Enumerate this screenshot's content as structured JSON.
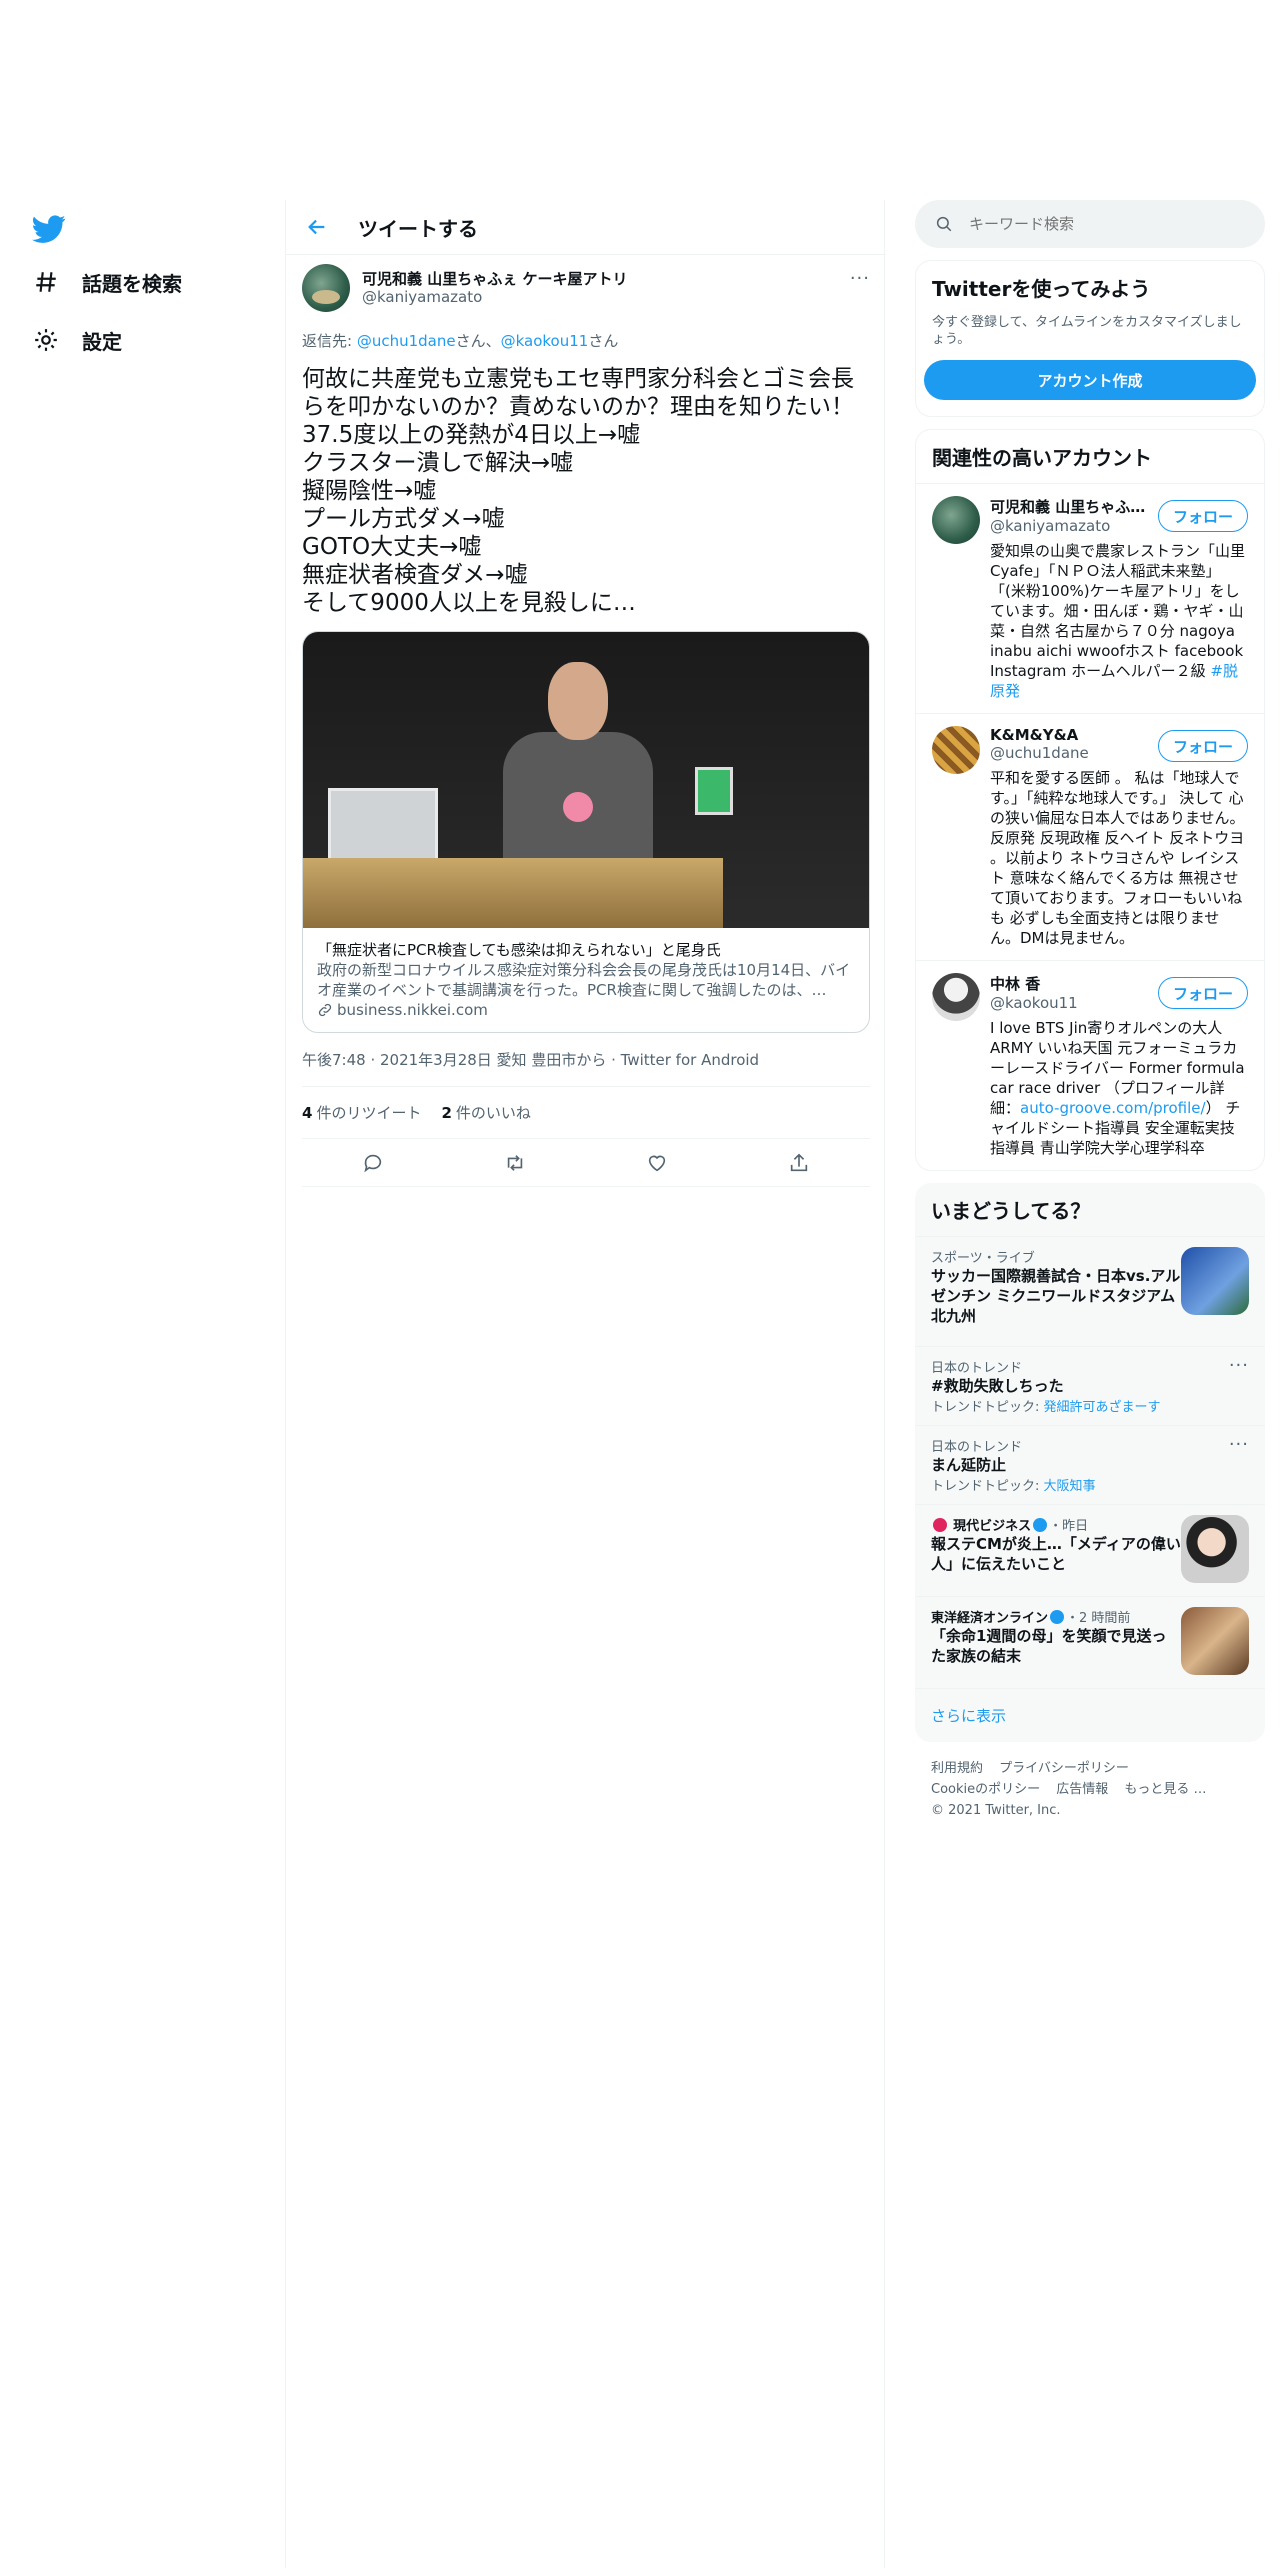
{
  "nav": {
    "explore_label": "話題を検索",
    "settings_label": "設定"
  },
  "header": {
    "title": "ツイートする"
  },
  "tweet": {
    "author_name": "可児和義 山里ちゃふぇ ケーキ屋アトリ",
    "author_handle": "@kaniyamazato",
    "more": "···",
    "reply_prefix": "返信先: ",
    "reply_user1": "@uchu1dane",
    "reply_san1": "さん、",
    "reply_user2": "@kaokou11",
    "reply_san2": "さん",
    "text": "何故に共産党も立憲党もエセ専門家分科会とゴミ会長らを叩かないのか？責めないのか？理由を知りたい！\n37.5度以上の発熱が4日以上→嘘\nクラスター潰しで解決→嘘\n擬陽陰性→嘘\nプール方式ダメ→嘘\nGOTO大丈夫→嘘\n無症状者検査ダメ→嘘\nそして9000人以上を見殺しに…",
    "card": {
      "title": "「無症状者にPCR検査しても感染は抑えられない」と尾身氏",
      "desc": "政府の新型コロナウイルス感染症対策分科会会長の尾身茂氏は10月14日、バイオ産業のイベントで基調講演を行った。PCR検査に関して強調したのは、…",
      "domain": "business.nikkei.com"
    },
    "meta": "午後7:48 · 2021年3月28日 愛知 豊田市から · Twitter for Android",
    "retweets_count": "4",
    "retweets_label": "件のリツイート",
    "likes_count": "2",
    "likes_label": "件のいいね"
  },
  "search": {
    "placeholder": "キーワード検索"
  },
  "signup": {
    "title": "Twitterを使ってみよう",
    "desc": "今すぐ登録して、タイムラインをカスタマイズしましょう。",
    "button": "アカウント作成"
  },
  "related": {
    "title": "関連性の高いアカウント",
    "follow_label": "フォロー",
    "accounts": [
      {
        "name": "可児和義 山里ちゃふぇ ケーキ屋アトリ",
        "handle": "@kaniyamazato",
        "bio": "愛知県の山奥で農家レストラン「山里Cyafe」「ＮＰＯ法人稲武未来塾」「(米粉100%)ケーキ屋アトリ」をしています。畑・田んぼ・鶏・ヤギ・山菜・自然 名古屋から７０分 nagoya inabu aichi wwoofホスト facebook Instagram ホームヘルパー２級 ",
        "bio_link": "#脱原発"
      },
      {
        "name": "K&M&Y&A",
        "handle": "@uchu1dane",
        "bio": "平和を愛する医師 。 私は「地球人です。」「純粋な地球人です。」 決して 心の狭い偏屈な日本人ではありません。反原発 反現政権 反ヘイト 反ネトウヨ 。以前より ネトウヨさんや レイシスト 意味なく絡んでくる方は 無視させて頂いております。フォローもいいねも 必ずしも全面支持とは限りません。DMは見ません。"
      },
      {
        "name": "中林 香",
        "handle": "@kaokou11",
        "bio": "I love BTS Jin寄りオルペンの大人ARMY いいね天国 元フォーミュラカーレースドライバー Former formula car race driver （プロフィール詳細：",
        "bio_link": "auto-groove.com/profile/",
        "bio_end": "） チャイルドシート指導員 安全運転実技指導員 青山学院大学心理学科卒"
      }
    ]
  },
  "trends": {
    "title": "いまどうしてる？",
    "items": [
      {
        "context": "スポーツ・ライブ",
        "title": "サッカー国際親善試合・日本vs.アルゼンチン ミクニワールドスタジアム北九州"
      },
      {
        "context": "日本のトレンド",
        "title": "#救助失敗しちった",
        "sub_prefix": "トレンドトピック: ",
        "sub_link": "発細許可あざまーす"
      },
      {
        "context": "日本のトレンド",
        "title": "まん延防止",
        "sub_prefix": "トレンドトピック: ",
        "sub_link": "大阪知事"
      },
      {
        "context_source": "現代ビジネス",
        "context_time": "・昨日",
        "title": "報ステCMが炎上…「メディアの偉い人」に伝えたいこと"
      },
      {
        "context_source": "東洋経済オンライン",
        "context_time": "・2 時間前",
        "title": "「余命1週間の母」を笑顔で見送った家族の結末"
      }
    ],
    "show_more": "さらに表示"
  },
  "footer": {
    "terms": "利用規約",
    "privacy": "プライバシーポリシー",
    "cookie": "Cookieのポリシー",
    "ads": "広告情報",
    "more": "もっと見る …",
    "copyright": "© 2021 Twitter, Inc."
  },
  "colors": {
    "accent": "#1d9bf0",
    "text": "#0f1419",
    "secondary": "#536471"
  }
}
